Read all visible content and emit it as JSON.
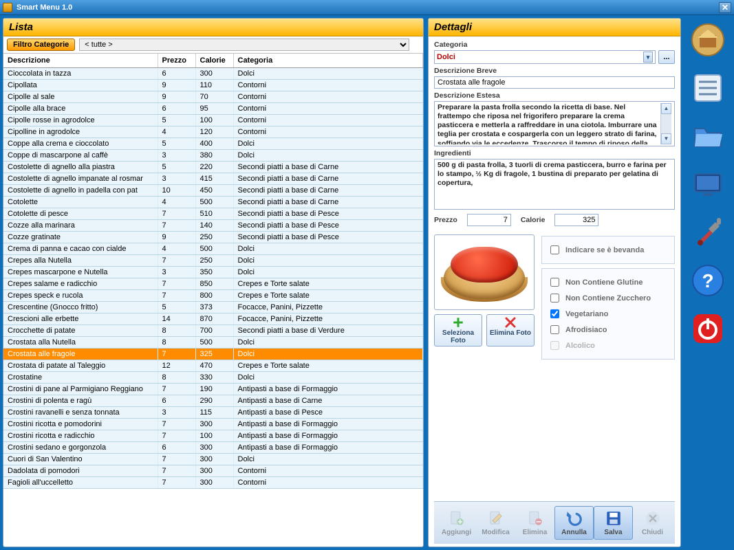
{
  "app": {
    "title": "Smart Menu 1.0"
  },
  "panels": {
    "list_title": "Lista",
    "details_title": "Dettagli"
  },
  "filter": {
    "button_label": "Filtro Categorie",
    "value": "< tutte >"
  },
  "columns": {
    "desc": "Descrizione",
    "prezzo": "Prezzo",
    "calorie": "Calorie",
    "categoria": "Categoria"
  },
  "selected_desc": "Crostata alle fragole",
  "rows": [
    {
      "desc": "Cioccolata in tazza",
      "prezzo": "6",
      "calorie": "300",
      "categoria": "Dolci"
    },
    {
      "desc": "Cipollata",
      "prezzo": "9",
      "calorie": "110",
      "categoria": "Contorni"
    },
    {
      "desc": "Cipolle al sale",
      "prezzo": "9",
      "calorie": "70",
      "categoria": "Contorni"
    },
    {
      "desc": "Cipolle alla brace",
      "prezzo": "6",
      "calorie": "95",
      "categoria": "Contorni"
    },
    {
      "desc": "Cipolle rosse in agrodolce",
      "prezzo": "5",
      "calorie": "100",
      "categoria": "Contorni"
    },
    {
      "desc": "Cipolline in agrodolce",
      "prezzo": "4",
      "calorie": "120",
      "categoria": "Contorni"
    },
    {
      "desc": "Coppe alla crema e cioccolato",
      "prezzo": "5",
      "calorie": "400",
      "categoria": "Dolci"
    },
    {
      "desc": "Coppe di mascarpone al caffè",
      "prezzo": "3",
      "calorie": "380",
      "categoria": "Dolci"
    },
    {
      "desc": "Costolette di agnello alla piastra",
      "prezzo": "5",
      "calorie": "220",
      "categoria": "Secondi piatti a base di Carne"
    },
    {
      "desc": "Costolette di agnello impanate al rosmar",
      "prezzo": "3",
      "calorie": "415",
      "categoria": "Secondi piatti a base di Carne"
    },
    {
      "desc": "Costolette di agnello in padella con pat",
      "prezzo": "10",
      "calorie": "450",
      "categoria": "Secondi piatti a base di Carne"
    },
    {
      "desc": "Cotolette",
      "prezzo": "4",
      "calorie": "500",
      "categoria": "Secondi piatti a base di Carne"
    },
    {
      "desc": "Cotolette di pesce",
      "prezzo": "7",
      "calorie": "510",
      "categoria": "Secondi piatti a base di Pesce"
    },
    {
      "desc": "Cozze alla marinara",
      "prezzo": "7",
      "calorie": "140",
      "categoria": "Secondi piatti a base di Pesce"
    },
    {
      "desc": "Cozze gratinate",
      "prezzo": "9",
      "calorie": "250",
      "categoria": "Secondi piatti a base di Pesce"
    },
    {
      "desc": "Crema di panna e cacao con cialde",
      "prezzo": "4",
      "calorie": "500",
      "categoria": "Dolci"
    },
    {
      "desc": "Crepes alla Nutella",
      "prezzo": "7",
      "calorie": "250",
      "categoria": "Dolci"
    },
    {
      "desc": "Crepes mascarpone e Nutella",
      "prezzo": "3",
      "calorie": "350",
      "categoria": "Dolci"
    },
    {
      "desc": "Crepes salame e radicchio",
      "prezzo": "7",
      "calorie": "850",
      "categoria": "Crepes e Torte salate"
    },
    {
      "desc": "Crepes speck e rucola",
      "prezzo": "7",
      "calorie": "800",
      "categoria": "Crepes e Torte salate"
    },
    {
      "desc": "Crescentine (Gnocco fritto)",
      "prezzo": "5",
      "calorie": "373",
      "categoria": "Focacce, Panini, Pizzette"
    },
    {
      "desc": "Crescioni alle erbette",
      "prezzo": "14",
      "calorie": "870",
      "categoria": "Focacce, Panini, Pizzette"
    },
    {
      "desc": "Crocchette di patate",
      "prezzo": "8",
      "calorie": "700",
      "categoria": "Secondi piatti a base di Verdure"
    },
    {
      "desc": "Crostata alla Nutella",
      "prezzo": "8",
      "calorie": "500",
      "categoria": "Dolci"
    },
    {
      "desc": "Crostata alle fragole",
      "prezzo": "7",
      "calorie": "325",
      "categoria": "Dolci"
    },
    {
      "desc": "Crostata di patate al Taleggio",
      "prezzo": "12",
      "calorie": "470",
      "categoria": "Crepes e Torte salate"
    },
    {
      "desc": "Crostatine",
      "prezzo": "8",
      "calorie": "330",
      "categoria": "Dolci"
    },
    {
      "desc": "Crostini di pane al Parmigiano Reggiano",
      "prezzo": "7",
      "calorie": "190",
      "categoria": "Antipasti a base di Formaggio"
    },
    {
      "desc": "Crostini di polenta e ragù",
      "prezzo": "6",
      "calorie": "290",
      "categoria": "Antipasti a base di Carne"
    },
    {
      "desc": "Crostini ravanelli e senza tonnata",
      "prezzo": "3",
      "calorie": "115",
      "categoria": "Antipasti a base di Pesce"
    },
    {
      "desc": "Crostini ricotta e pomodorini",
      "prezzo": "7",
      "calorie": "300",
      "categoria": "Antipasti a base di Formaggio"
    },
    {
      "desc": "Crostini ricotta e radicchio",
      "prezzo": "7",
      "calorie": "100",
      "categoria": "Antipasti a base di Formaggio"
    },
    {
      "desc": "Crostini sedano e gorgonzola",
      "prezzo": "6",
      "calorie": "300",
      "categoria": "Antipasti a base di Formaggio"
    },
    {
      "desc": "Cuori di San Valentino",
      "prezzo": "7",
      "calorie": "300",
      "categoria": "Dolci"
    },
    {
      "desc": "Dadolata di pomodori",
      "prezzo": "7",
      "calorie": "300",
      "categoria": "Contorni"
    },
    {
      "desc": "Fagioli all'uccelletto",
      "prezzo": "7",
      "calorie": "300",
      "categoria": "Contorni"
    }
  ],
  "details": {
    "labels": {
      "categoria": "Categoria",
      "desc_breve": "Descrizione Breve",
      "desc_estesa": "Descrizione Estesa",
      "ingredienti": "Ingredienti",
      "prezzo": "Prezzo",
      "calorie": "Calorie"
    },
    "categoria": "Dolci",
    "desc_breve": "Crostata alle fragole",
    "desc_estesa": "Preparare la pasta frolla secondo la ricetta di base. Nel frattempo che riposa nel frigorifero preparare la crema pasticcera e metterla a raffreddare in una ciotola. Imburrare una teglia per crostata e cospargerla con un leggero strato di farina, soffiando via le eccedenze.  Trascorso il tempo di riposo della pasta, accendere il",
    "ingredienti": "500 g di pasta frolla, 3 tuorli di crema pasticcera, burro e farina per lo stampo, ½ Kg di fragole, 1 bustina di preparato per gelatina di copertura,",
    "prezzo": "7",
    "calorie": "325",
    "photo_btns": {
      "select": "Seleziona Foto",
      "delete": "Elimina Foto"
    },
    "flags": {
      "bevanda": "Indicare se è bevanda",
      "glutine": "Non Contiene Glutine",
      "zucchero": "Non Contiene Zucchero",
      "vegetariano": "Vegetariano",
      "afrodisiaco": "Afrodisiaco",
      "alcolico": "Alcolico"
    },
    "flag_values": {
      "bevanda": false,
      "glutine": false,
      "zucchero": false,
      "vegetariano": true,
      "afrodisiaco": false,
      "alcolico": false
    }
  },
  "toolbar": {
    "aggiungi": "Aggiungi",
    "modifica": "Modifica",
    "elimina": "Elimina",
    "annulla": "Annulla",
    "salva": "Salva",
    "chiudi": "Chiudi"
  }
}
